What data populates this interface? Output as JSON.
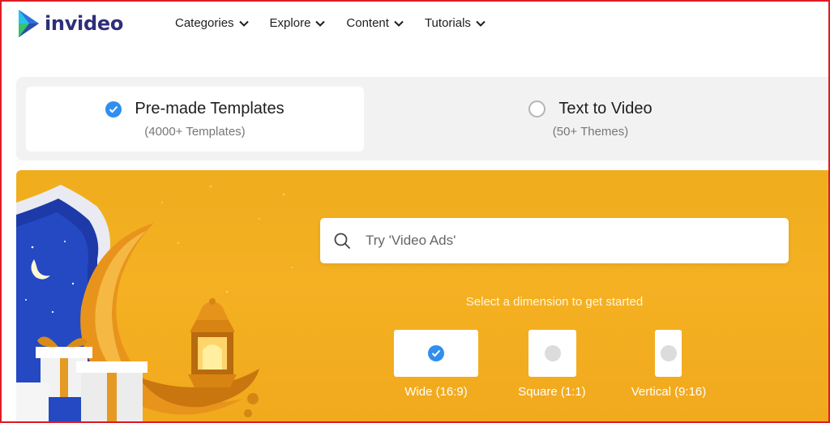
{
  "brand": {
    "name": "invideo",
    "logo_icon": "play-triangle-logo",
    "text_color": "#2f2f7a"
  },
  "nav": {
    "items": [
      {
        "label": "Categories",
        "icon": "chevron-down-icon"
      },
      {
        "label": "Explore",
        "icon": "chevron-down-icon"
      },
      {
        "label": "Content",
        "icon": "chevron-down-icon"
      },
      {
        "label": "Tutorials",
        "icon": "chevron-down-icon"
      }
    ]
  },
  "modes": [
    {
      "title": "Pre-made Templates",
      "subtitle": "(4000+ Templates)",
      "selected": true
    },
    {
      "title": "Text to Video",
      "subtitle": "(50+ Themes)",
      "selected": false
    }
  ],
  "search": {
    "placeholder": "Try 'Video Ads'",
    "icon": "search-icon"
  },
  "dimension_prompt": "Select a dimension to get started",
  "dimensions": [
    {
      "label": "Wide (16:9)",
      "selected": true
    },
    {
      "label": "Square (1:1)",
      "selected": false
    },
    {
      "label": "Vertical (9:16)",
      "selected": false
    }
  ],
  "colors": {
    "accent_blue": "#2f8ef0",
    "banner_yellow": "#f4b122",
    "frame_red": "#e01b24"
  }
}
